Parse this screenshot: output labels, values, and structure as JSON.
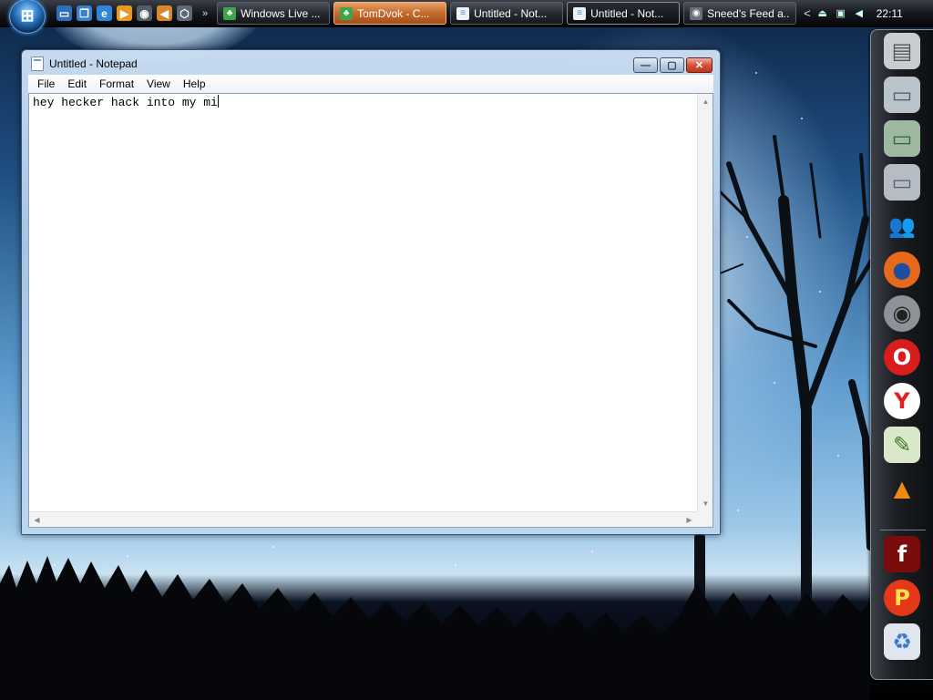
{
  "taskbar": {
    "start_label": "Start",
    "more_glyph": "»",
    "quicklaunch": [
      {
        "name": "show-desktop-icon",
        "color": "#2d6fb8"
      },
      {
        "name": "switch-windows-icon",
        "color": "#3a7fd0"
      },
      {
        "name": "internet-explorer-icon",
        "color": "#2f86d8"
      },
      {
        "name": "media-player-icon",
        "color": "#e89a20"
      },
      {
        "name": "rss-reader-icon",
        "color": "#555c66"
      },
      {
        "name": "volume-icon",
        "color": "#d8882a"
      },
      {
        "name": "virtualbox-icon",
        "color": "#5d6a7a"
      }
    ],
    "tasks": [
      {
        "label": "Windows Live ...",
        "icon": "messenger-icon",
        "state": "normal"
      },
      {
        "label": "TomDvok - C...",
        "icon": "messenger-icon",
        "state": "orange"
      },
      {
        "label": "Untitled - Not...",
        "icon": "notepad-icon",
        "state": "normal"
      },
      {
        "label": "Untitled - Not...",
        "icon": "notepad-icon",
        "state": "active"
      },
      {
        "label": "Sneed's Feed a...",
        "icon": "rss-reader-icon",
        "state": "normal"
      }
    ],
    "tray_chevron": "<",
    "clock": "22:11"
  },
  "window": {
    "title": "Untitled - Notepad",
    "minimize_glyph": "—",
    "maximize_glyph": "▢",
    "close_glyph": "✕",
    "menu": [
      "File",
      "Edit",
      "Format",
      "View",
      "Help"
    ],
    "content": "hey hecker hack into my mi"
  },
  "dock": {
    "items": [
      {
        "name": "computer-icon",
        "glyph": "▤",
        "bg": "#c9ccd0",
        "fg": "#555"
      },
      {
        "name": "documents-folder-icon",
        "glyph": "▭",
        "bg": "#b9c3cc",
        "fg": "#4a5a6a"
      },
      {
        "name": "green-folder-icon",
        "glyph": "▭",
        "bg": "#9fb8a0",
        "fg": "#2a6a2e"
      },
      {
        "name": "control-panel-folder-icon",
        "glyph": "▭",
        "bg": "#b5bcc4",
        "fg": "#55606c"
      },
      {
        "name": "messenger-contacts-icon",
        "glyph": "👥",
        "bg": "rgba(0,0,0,0)",
        "fg": "#5ab04a"
      },
      {
        "name": "firefox-icon",
        "glyph": "●",
        "bg": "#e66a1a",
        "fg": "#1d4fa0"
      },
      {
        "name": "rss-raccoon-icon",
        "glyph": "◉",
        "bg": "#8e9298",
        "fg": "#222"
      },
      {
        "name": "opera-icon",
        "glyph": "O",
        "bg": "#d81d1d",
        "fg": "#ffffff"
      },
      {
        "name": "yandex-icon",
        "glyph": "Y",
        "bg": "#ffffff",
        "fg": "#e02020"
      },
      {
        "name": "notepad-plus-icon",
        "glyph": "✎",
        "bg": "#d8e8c8",
        "fg": "#3a7a2a"
      },
      {
        "name": "vlc-icon",
        "glyph": "▲",
        "bg": "rgba(0,0,0,0)",
        "fg": "#f08a10"
      },
      {
        "name": "flash-icon",
        "glyph": "f",
        "bg": "#7a0c0c",
        "fg": "#ffffff"
      },
      {
        "name": "pidgin-p-icon",
        "glyph": "P",
        "bg": "#e43818",
        "fg": "#ffe050"
      },
      {
        "name": "recycle-bin-icon",
        "glyph": "♻",
        "bg": "#dfe6ee",
        "fg": "#3a7ad0"
      }
    ]
  }
}
